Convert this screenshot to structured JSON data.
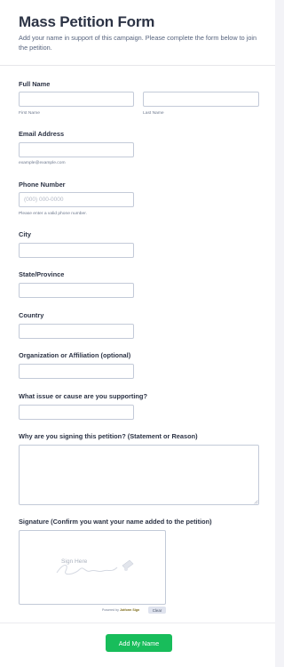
{
  "header": {
    "title": "Mass Petition Form",
    "subtitle": "Add your name in support of this campaign. Please complete the form below to join the petition."
  },
  "fields": {
    "full_name": {
      "label": "Full Name",
      "first_sublabel": "First Name",
      "last_sublabel": "Last Name",
      "first_value": "",
      "last_value": ""
    },
    "email": {
      "label": "Email Address",
      "sublabel": "example@example.com",
      "value": ""
    },
    "phone": {
      "label": "Phone Number",
      "placeholder": "(000) 000-0000",
      "sublabel": "Please enter a valid phone number.",
      "value": ""
    },
    "city": {
      "label": "City",
      "value": ""
    },
    "state": {
      "label": "State/Province",
      "value": ""
    },
    "country": {
      "label": "Country",
      "value": ""
    },
    "organization": {
      "label": "Organization or Affiliation (optional)",
      "value": ""
    },
    "issue": {
      "label": "What issue or cause are you supporting?",
      "value": ""
    },
    "reason": {
      "label": "Why are you signing this petition? (Statement or Reason)",
      "value": ""
    },
    "signature": {
      "label": "Signature (Confirm you want your name added to the petition)",
      "placeholder": "Sign Here",
      "powered_prefix": "Powered by",
      "powered_brand": "Jotform Sign",
      "clear_label": "Clear"
    }
  },
  "submit": {
    "label": "Add My Name"
  },
  "colors": {
    "accent": "#18bd5b",
    "text": "#2c3345",
    "border": "#c3cad8"
  }
}
